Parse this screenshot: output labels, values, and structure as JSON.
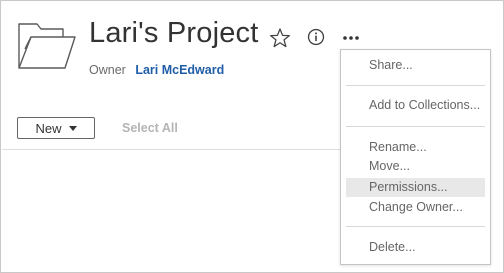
{
  "project": {
    "title": "Lari's Project",
    "owner_label": "Owner",
    "owner_name": "Lari McEdward"
  },
  "actions": {
    "favorite_icon": "star-icon",
    "info_icon": "info-icon",
    "more_icon": "more-icon"
  },
  "toolbar": {
    "new_label": "New",
    "select_all_label": "Select All"
  },
  "menu": {
    "items": [
      {
        "label": "Share..."
      },
      {
        "label": "Add to Collections..."
      },
      {
        "label": "Rename..."
      },
      {
        "label": "Move..."
      },
      {
        "label": "Permissions...",
        "highlighted": true
      },
      {
        "label": "Change Owner..."
      },
      {
        "label": "Delete..."
      }
    ]
  },
  "colors": {
    "title": "#333333",
    "owner_link": "#1f5da8",
    "menu_text": "#666666",
    "menu_highlight": "#e8e8e8",
    "disabled": "#b4b4b4"
  }
}
